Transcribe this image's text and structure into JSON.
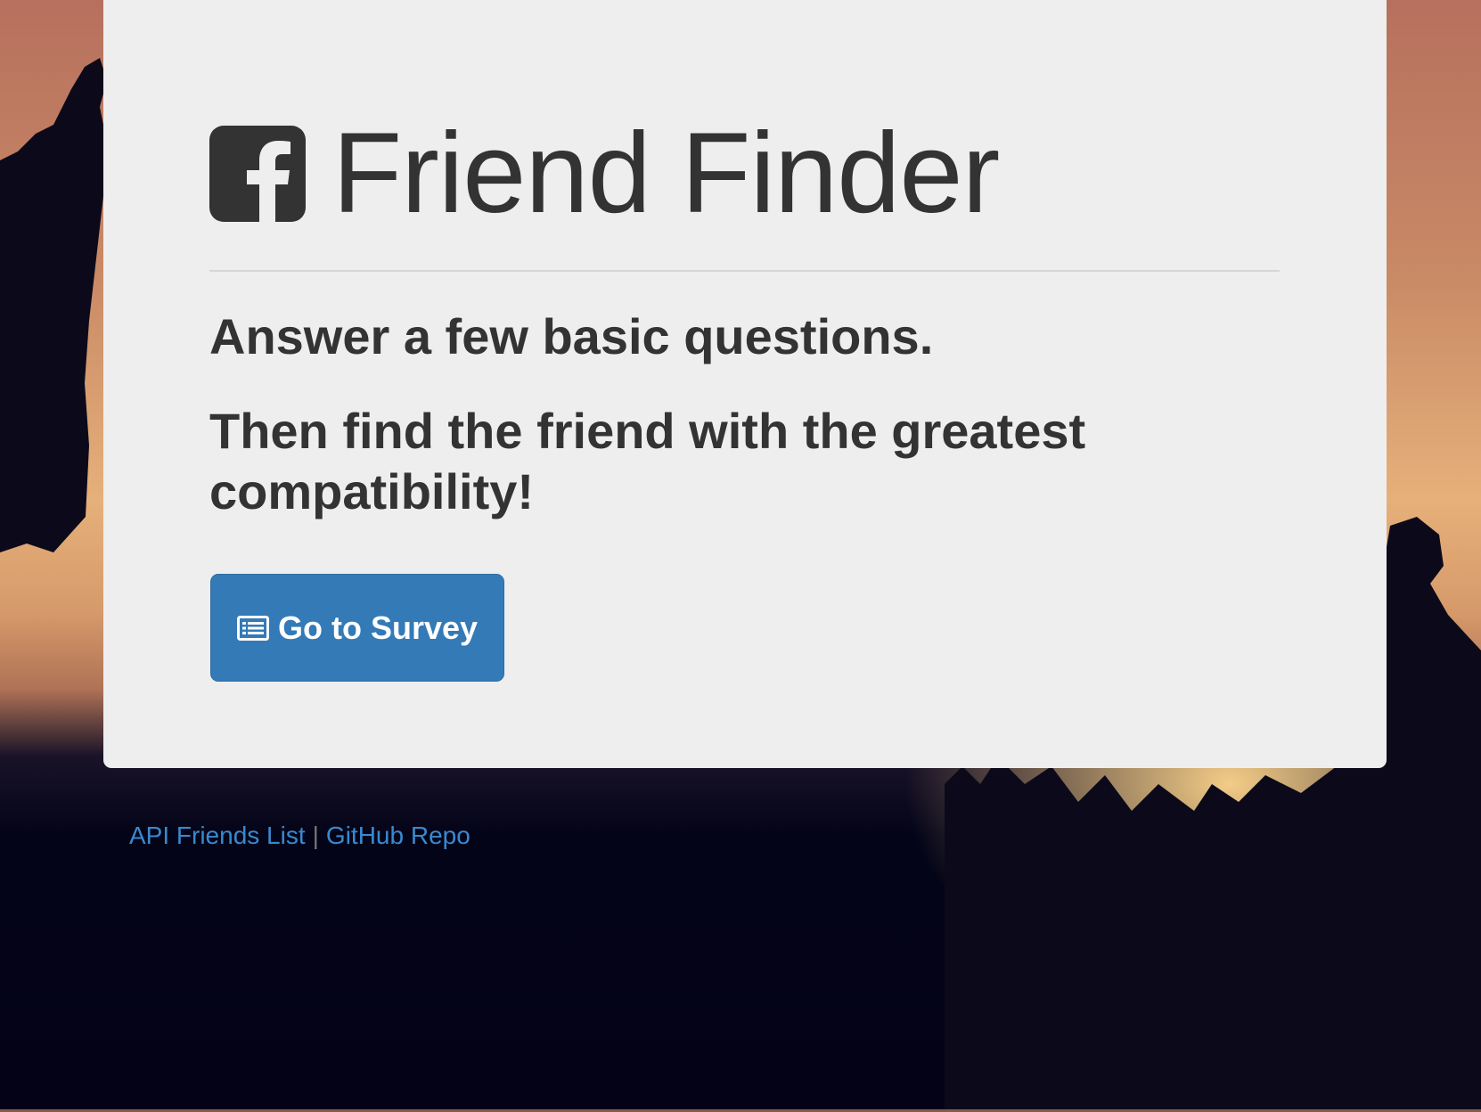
{
  "page": {
    "title": "Friend Finder",
    "brand_icon": "facebook-square-icon"
  },
  "hero": {
    "lead_1": "Answer a few basic questions.",
    "lead_2": "Then find the friend with the greatest compatibility!",
    "button": {
      "label": "Go to Survey",
      "icon": "list-alt-icon",
      "color": "#337ab7"
    }
  },
  "footer": {
    "links": [
      {
        "label": "API Friends List"
      },
      {
        "label": "GitHub Repo"
      }
    ],
    "separator": "|",
    "link_color": "#3a89cf"
  },
  "colors": {
    "panel": "#eeeeee",
    "text": "#333333"
  }
}
